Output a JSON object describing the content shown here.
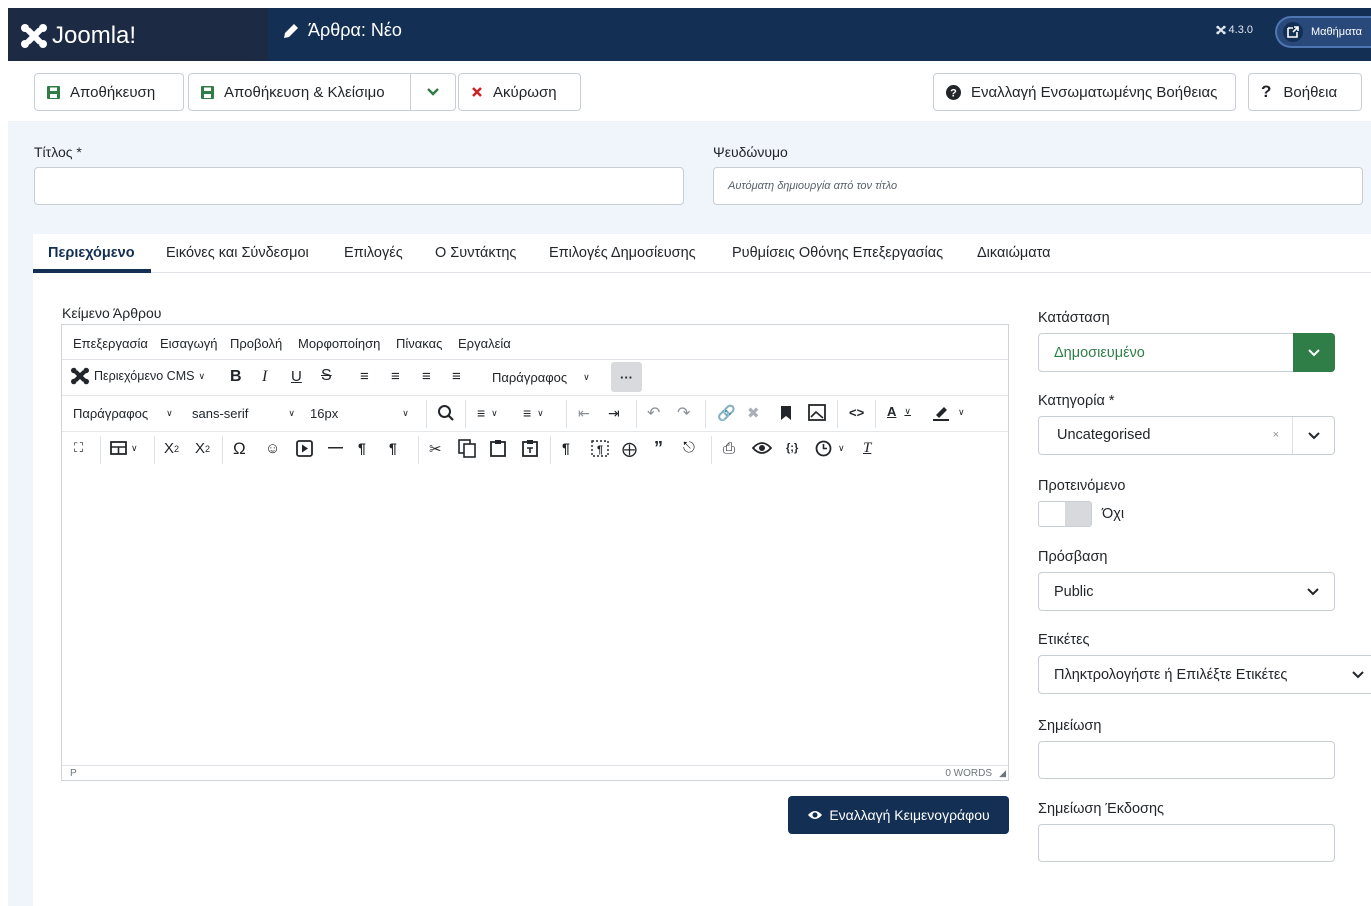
{
  "header": {
    "brand": "Joomla!",
    "page_title": "Άρθρα: Νέο",
    "version": "4.3.0",
    "lessons": "Μαθήματα"
  },
  "toolbar": {
    "save": "Αποθήκευση",
    "save_close": "Αποθήκευση & Κλείσιμο",
    "cancel": "Ακύρωση",
    "inline_help": "Εναλλαγή Ενσωματωμένης Βοήθειας",
    "help": "Βοήθεια"
  },
  "form": {
    "title_label": "Τίτλος *",
    "title_value": "",
    "alias_label": "Ψευδώνυμο",
    "alias_placeholder": "Αυτόματη δημιουργία από τον τίτλο"
  },
  "tabs": [
    "Περιεχόμενο",
    "Εικόνες και Σύνδεσμοι",
    "Επιλογές",
    "Ο Συντάκτης",
    "Επιλογές Δημοσίευσης",
    "Ρυθμίσεις Οθόνης Επεξεργασίας",
    "Δικαιώματα"
  ],
  "editor": {
    "label": "Κείμενο Άρθρου",
    "menu": [
      "Επεξεργασία",
      "Εισαγωγή",
      "Προβολή",
      "Μορφοποίηση",
      "Πίνακας",
      "Εργαλεία"
    ],
    "cms_content": "Περιεχόμενο CMS",
    "block_format_1": "Παράγραφος",
    "block_format_2": "Παράγραφος",
    "font_family": "sans-serif",
    "font_size": "16px",
    "status_path": "P",
    "word_count": "0 WORDS",
    "toggle_button": "Εναλλαγή Κειμενογράφου"
  },
  "sidebar": {
    "status_label": "Κατάσταση",
    "status_value": "Δημοσιευμένο",
    "category_label": "Κατηγορία *",
    "category_value": "Uncategorised",
    "featured_label": "Προτεινόμενο",
    "featured_value": "Όχι",
    "access_label": "Πρόσβαση",
    "access_value": "Public",
    "tags_label": "Ετικέτες",
    "tags_placeholder": "Πληκτρολογήστε ή Επιλέξτε Ετικέτες",
    "note_label": "Σημείωση",
    "version_note_label": "Σημείωση Έκδοσης"
  },
  "colors": {
    "header_dark": "#1d2a43",
    "header_blue": "#132f53",
    "status_green": "#2f7d47",
    "cancel_red": "#c52827"
  }
}
